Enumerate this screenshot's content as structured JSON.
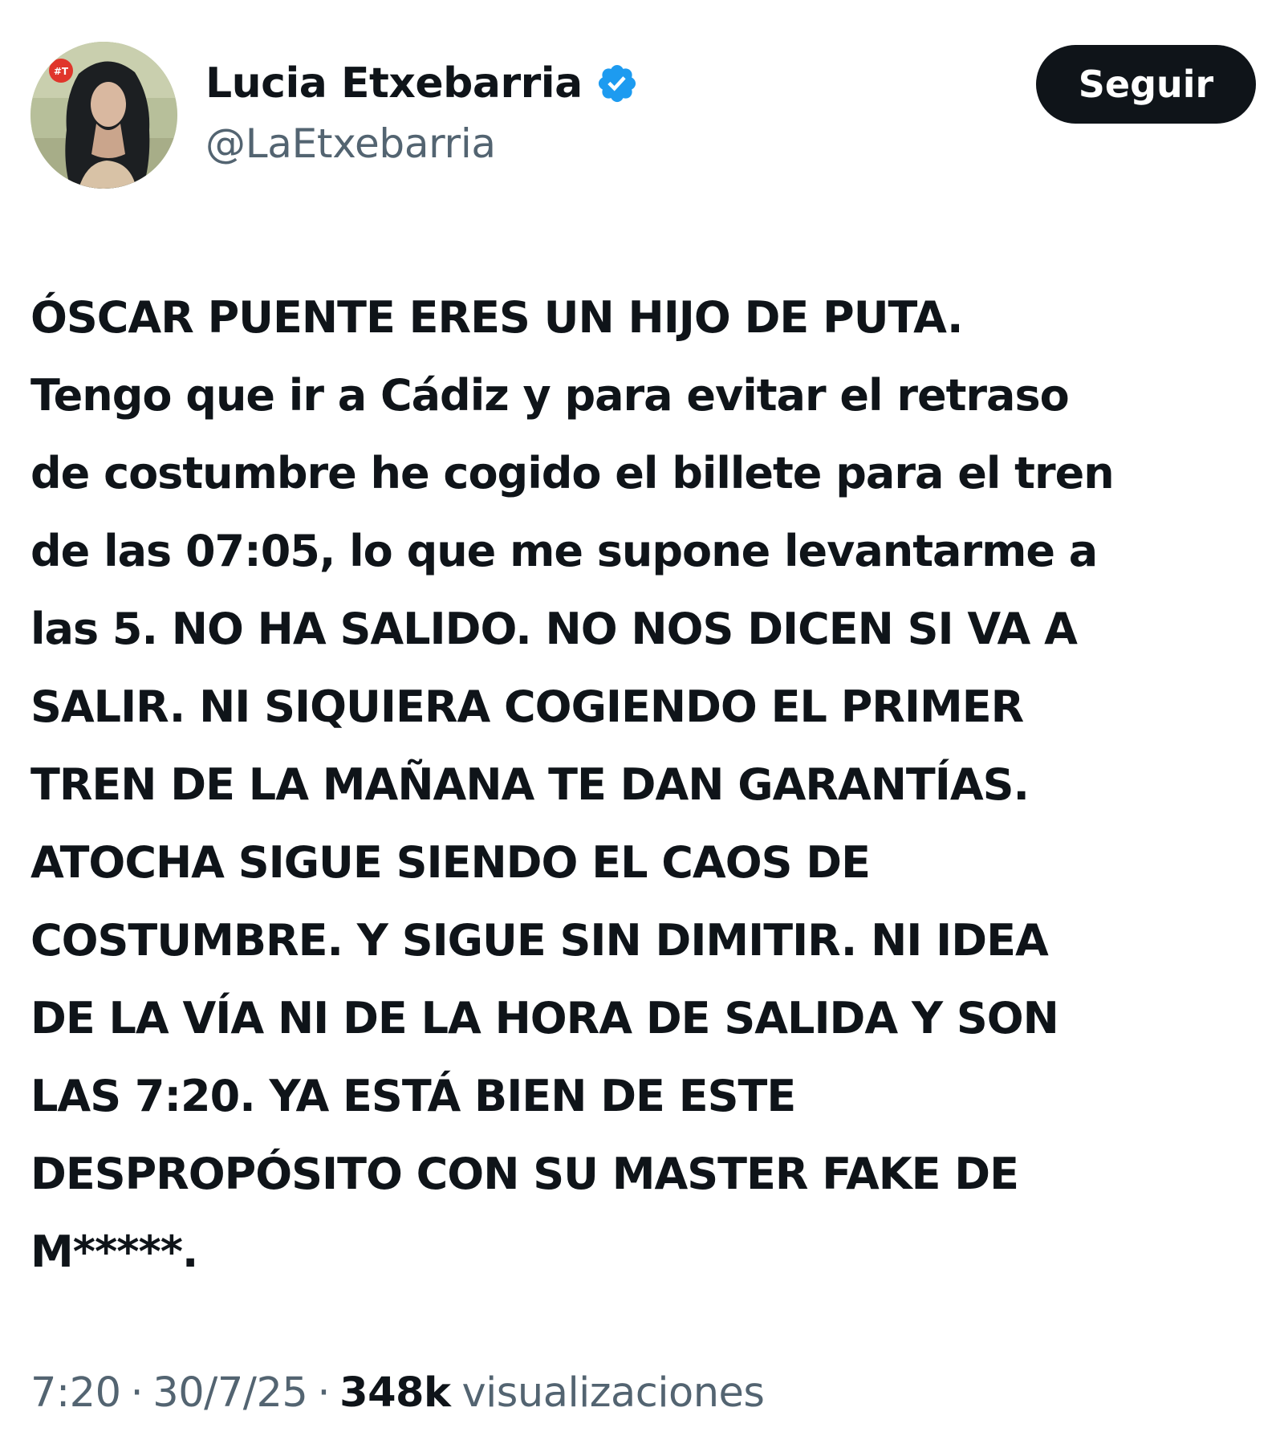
{
  "author": {
    "name": "Lucia Etxebarria",
    "handle": "@LaEtxebarria",
    "verified": true,
    "avatar_badge": "#T"
  },
  "follow_button": {
    "label": "Seguir"
  },
  "tweet": {
    "lines": [
      "ÓSCAR PUENTE ERES UN HIJO DE PUTA.",
      "Tengo que ir a Cádiz y para evitar el retraso",
      "de costumbre he cogido el billete para el tren",
      "de las 07:05, lo que me supone levantarme a",
      "las 5. NO HA SALIDO. NO NOS DICEN SI VA A",
      "SALIR. NI SIQUIERA COGIENDO EL PRIMER",
      "TREN DE LA MAÑANA TE DAN GARANTÍAS.",
      "ATOCHA SIGUE SIENDO EL CAOS DE",
      "COSTUMBRE. Y SIGUE SIN DIMITIR.  NI IDEA",
      "DE LA VÍA NI DE LA HORA DE SALIDA Y SON",
      "LAS 7:20. YA ESTÁ BIEN DE ESTE",
      "DESPROPÓSITO CON SU MASTER FAKE DE",
      "M*****."
    ]
  },
  "meta": {
    "time": "7:20",
    "separator": "·",
    "date": "30/7/25",
    "views_count": "348k",
    "views_label": "visualizaciones"
  },
  "colors": {
    "text_primary": "#0f1419",
    "text_secondary": "#536471",
    "verified_blue": "#1d9bf0",
    "button_bg": "#0f1419",
    "button_text": "#ffffff",
    "background": "#ffffff"
  },
  "icons": {
    "verified": "verified-badge-icon"
  }
}
